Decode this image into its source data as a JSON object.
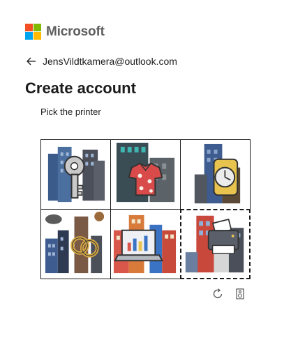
{
  "brand": {
    "name": "Microsoft"
  },
  "identity": {
    "email": "JensVildtkamera@outlook.com"
  },
  "page": {
    "title": "Create account",
    "prompt": "Pick the printer"
  },
  "challenge": {
    "tiles": [
      {
        "id": "key-city",
        "icon": "key-icon"
      },
      {
        "id": "shirt-city",
        "icon": "shirt-icon"
      },
      {
        "id": "watch-city",
        "icon": "watch-icon"
      },
      {
        "id": "rings-city",
        "icon": "rings-icon"
      },
      {
        "id": "laptop-city",
        "icon": "laptop-icon"
      },
      {
        "id": "printer-city",
        "icon": "printer-icon",
        "focused": true
      }
    ]
  },
  "controls": {
    "reload_icon": "refresh-icon",
    "audio_icon": "speaker-icon"
  },
  "colors": {
    "ms_red": "#f25022",
    "ms_green": "#7fba00",
    "ms_blue": "#00a4ef",
    "ms_yellow": "#ffb900",
    "text": "#1b1b1b"
  }
}
